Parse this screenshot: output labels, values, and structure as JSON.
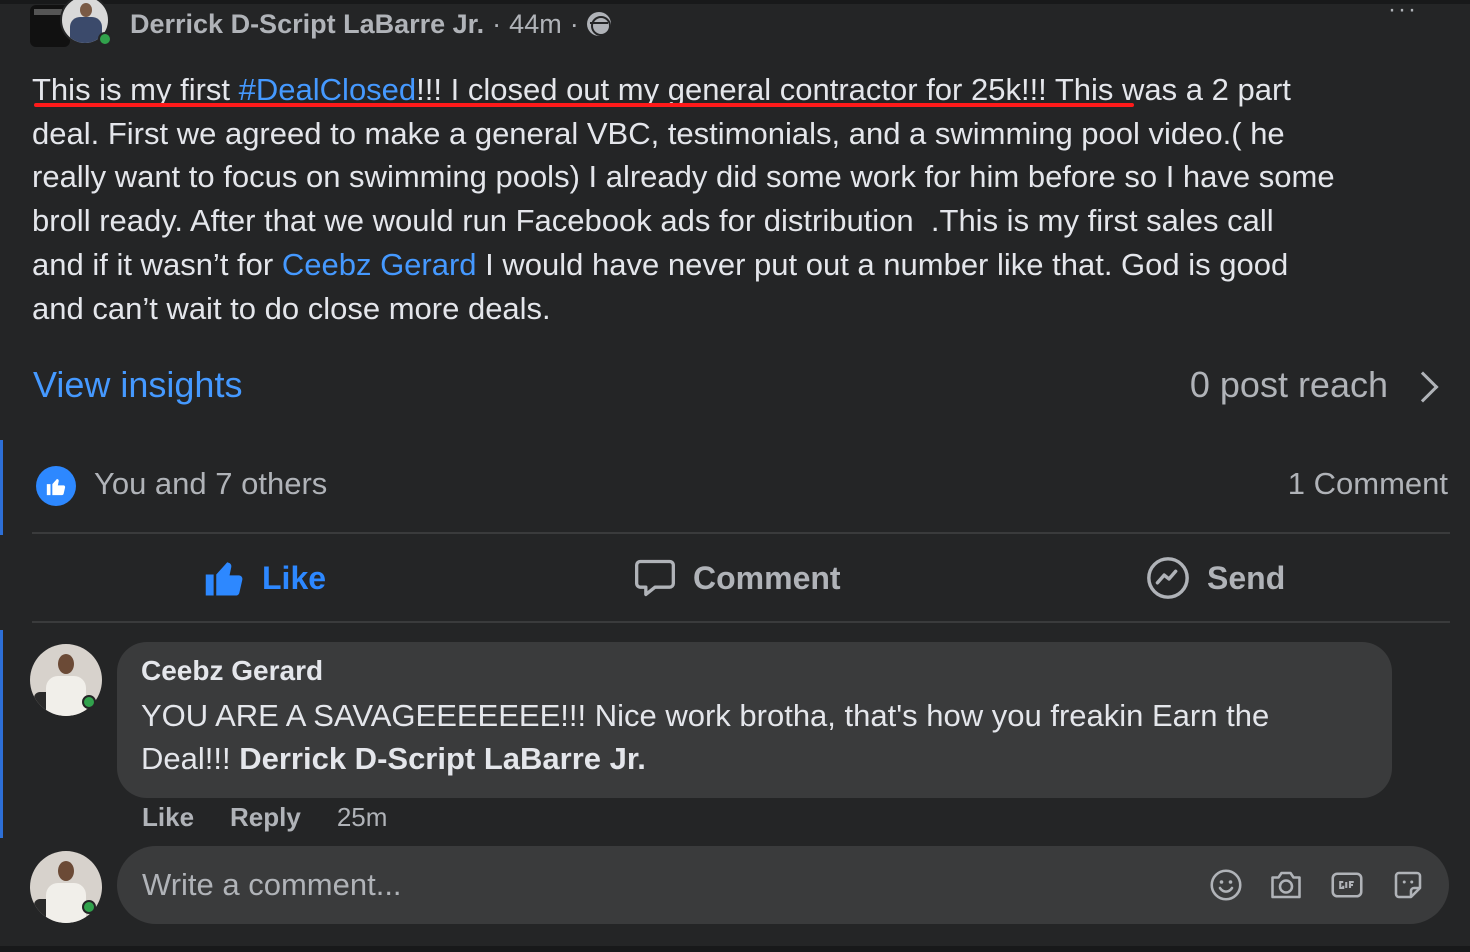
{
  "header": {
    "author": "Derrick D-Script LaBarre Jr.",
    "time": "44m",
    "separator": "·",
    "more": "···"
  },
  "post": {
    "line1_a": "This is my first ",
    "hashtag": "#DealClosed",
    "line1_b": "!!! I closed out my general contractor for 25k!!! This was a 2 part",
    "line2": "deal. First we agreed to make a general VBC, testimonials, and a swimming pool video.( he",
    "line3": "really want to focus on swimming pools) I already did some work for him before so I have some",
    "line4": "broll ready. After that we would run Facebook ads for distribution  .This is my first sales call",
    "line5_a": "and if it wasn’t for ",
    "mention": "Ceebz Gerard",
    "line5_b": " I would have never put out a number like that. God is good",
    "line6": "and can’t wait to do close more deals."
  },
  "insights": {
    "link_label": "View insights",
    "reach": "0 post reach"
  },
  "reactions": {
    "summary": "You and 7 others",
    "comments": "1 Comment"
  },
  "actions": {
    "like": "Like",
    "comment": "Comment",
    "send": "Send"
  },
  "comment": {
    "name": "Ceebz Gerard",
    "text_line1": "YOU ARE A SAVAGEEEEEEE!!! Nice work brotha, that's how you freakin Earn the",
    "text_line2_a": "Deal!!! ",
    "text_line2_mention": "Derrick D-Script LaBarre Jr.",
    "like": "Like",
    "reply": "Reply",
    "time": "25m"
  },
  "composer": {
    "placeholder": "Write a comment...",
    "icons": [
      "smiley-icon",
      "camera-icon",
      "gif-icon",
      "sticker-icon"
    ]
  },
  "colors": {
    "background": "#242526",
    "link": "#4599ff",
    "like_blue": "#2d88ff",
    "muted": "#b0b3b8",
    "underline_red": "#ff1a1a"
  }
}
